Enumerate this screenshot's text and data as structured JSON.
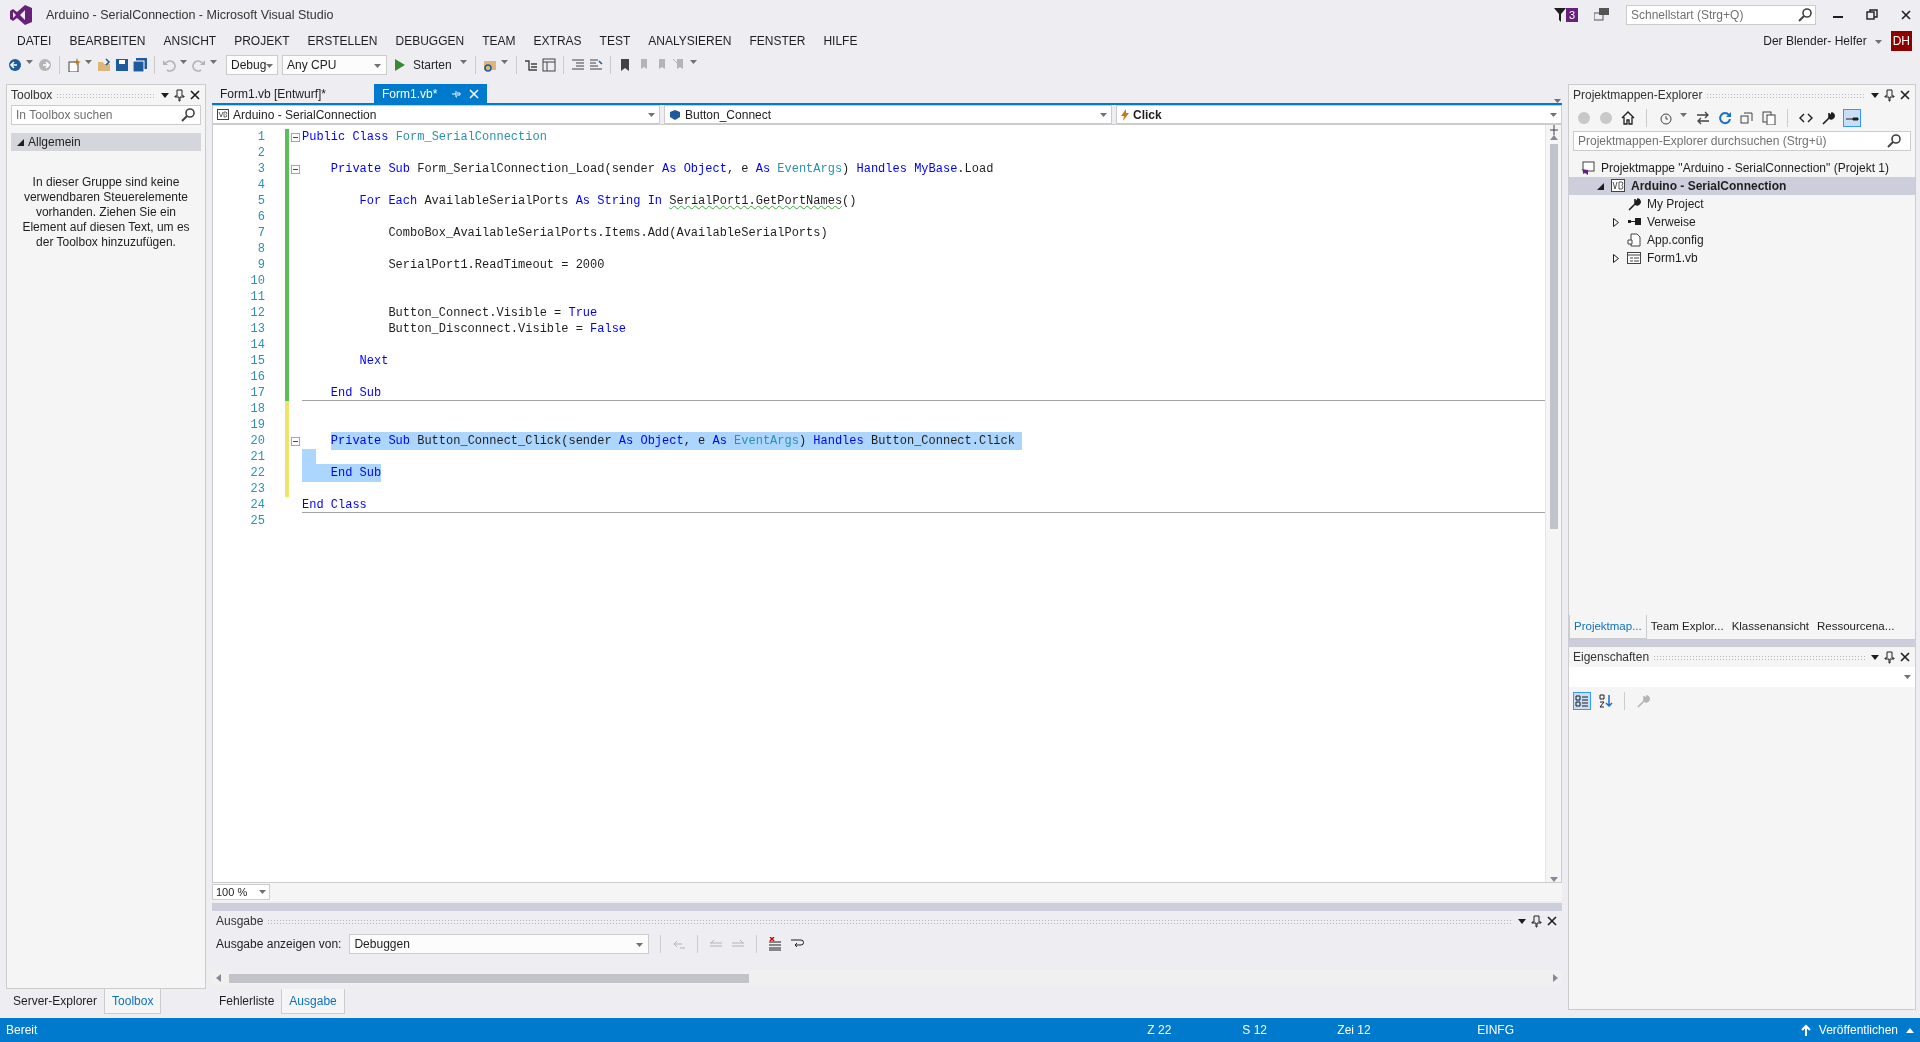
{
  "window": {
    "title": "Arduino - SerialConnection - Microsoft Visual Studio",
    "notification_count": "3",
    "quick_launch": {
      "placeholder": "Schnellstart (Strg+Q)"
    },
    "user": "Der Blender- Helfer",
    "user_initials": "DH"
  },
  "menu": [
    "DATEI",
    "BEARBEITEN",
    "ANSICHT",
    "PROJEKT",
    "ERSTELLEN",
    "DEBUGGEN",
    "TEAM",
    "EXTRAS",
    "TEST",
    "ANALYSIEREN",
    "FENSTER",
    "HILFE"
  ],
  "toolbar": {
    "configuration": "Debug",
    "platform": "Any CPU",
    "start": "Starten"
  },
  "toolbox": {
    "title": "Toolbox",
    "search": {
      "placeholder": "In Toolbox suchen"
    },
    "group": {
      "label": "Allgemein",
      "expanded": true
    },
    "empty_text": "In dieser Gruppe sind keine verwendbaren Steuerelemente vorhanden. Ziehen Sie ein Element auf diesen Text, um es der Toolbox hinzuzufügen."
  },
  "left_tabs": [
    {
      "label": "Server-Explorer",
      "selected": false
    },
    {
      "label": "Toolbox",
      "selected": true
    }
  ],
  "document_tabs": [
    {
      "label": "Form1.vb [Entwurf]*",
      "selected": false
    },
    {
      "label": "Form1.vb*",
      "selected": true
    }
  ],
  "navigation_bar": {
    "project": "Arduino - SerialConnection",
    "object": "Button_Connect",
    "event": "Click"
  },
  "code_lines": [
    {
      "number": "1",
      "color": "#57c157",
      "fold": true,
      "selected": false,
      "separator": false,
      "tokens": [
        {
          "text": "Public Class ",
          "kind": "kw"
        },
        {
          "text": "Form_SerialConnection",
          "kind": "type"
        }
      ]
    },
    {
      "number": "2",
      "color": "#57c157",
      "fold": false,
      "selected": false,
      "separator": false
    },
    {
      "number": "3",
      "color": "#57c157",
      "fold": true,
      "selected": false,
      "separator": false,
      "tokens": [
        {
          "text": "    Private Sub ",
          "kind": "kw"
        },
        {
          "text": "Form_SerialConnection_Load(sender ",
          "kind": "plain"
        },
        {
          "text": "As Object",
          "kind": "kw"
        },
        {
          "text": ", e ",
          "kind": "plain"
        },
        {
          "text": "As ",
          "kind": "kw"
        },
        {
          "text": "EventArgs",
          "kind": "type"
        },
        {
          "text": ") ",
          "kind": "plain"
        },
        {
          "text": "Handles MyBase",
          "kind": "kw"
        },
        {
          "text": ".Load",
          "kind": "plain"
        }
      ]
    },
    {
      "number": "4",
      "color": "#57c157",
      "fold": false,
      "selected": false,
      "separator": false
    },
    {
      "number": "5",
      "color": "#57c157",
      "fold": false,
      "selected": false,
      "separator": false,
      "tokens": [
        {
          "text": "        For Each ",
          "kind": "kw"
        },
        {
          "text": "AvailableSerialPorts ",
          "kind": "plain"
        },
        {
          "text": "As String In ",
          "kind": "kw"
        },
        {
          "text": "SerialPort1.GetPortNames",
          "kind": "squiggle"
        },
        {
          "text": "()",
          "kind": "plain"
        }
      ]
    },
    {
      "number": "6",
      "color": "#57c157",
      "fold": false,
      "selected": false,
      "separator": false
    },
    {
      "number": "7",
      "color": "#57c157",
      "fold": false,
      "selected": false,
      "separator": false,
      "tokens": [
        {
          "text": "            ComboBox_AvailableSerialPorts.Items.Add(AvailableSerialPorts)",
          "kind": "plain"
        }
      ]
    },
    {
      "number": "8",
      "color": "#57c157",
      "fold": false,
      "selected": false,
      "separator": false
    },
    {
      "number": "9",
      "color": "#57c157",
      "fold": false,
      "selected": false,
      "separator": false,
      "tokens": [
        {
          "text": "            SerialPort1.ReadTimeout = 2000",
          "kind": "plain"
        }
      ]
    },
    {
      "number": "10",
      "color": "#57c157",
      "fold": false,
      "selected": false,
      "separator": false
    },
    {
      "number": "11",
      "color": "#57c157",
      "fold": false,
      "selected": false,
      "separator": false
    },
    {
      "number": "12",
      "color": "#57c157",
      "fold": false,
      "selected": false,
      "separator": false,
      "tokens": [
        {
          "text": "            Button_Connect.Visible = ",
          "kind": "plain"
        },
        {
          "text": "True",
          "kind": "kw"
        }
      ]
    },
    {
      "number": "13",
      "color": "#57c157",
      "fold": false,
      "selected": false,
      "separator": false,
      "tokens": [
        {
          "text": "            Button_Disconnect.Visible = ",
          "kind": "plain"
        },
        {
          "text": "False",
          "kind": "kw"
        }
      ]
    },
    {
      "number": "14",
      "color": "#57c157",
      "fold": false,
      "selected": false,
      "separator": false
    },
    {
      "number": "15",
      "color": "#57c157",
      "fold": false,
      "selected": false,
      "separator": false,
      "tokens": [
        {
          "text": "        Next",
          "kind": "kw"
        }
      ]
    },
    {
      "number": "16",
      "color": "#57c157",
      "fold": false,
      "selected": false,
      "separator": false
    },
    {
      "number": "17",
      "color": "#57c157",
      "fold": false,
      "selected": false,
      "separator": true,
      "tokens": [
        {
          "text": "    End Sub",
          "kind": "kw"
        }
      ]
    },
    {
      "number": "18",
      "color": "#efe46b",
      "fold": false,
      "selected": false,
      "separator": false
    },
    {
      "number": "19",
      "color": "#efe46b",
      "fold": false,
      "selected": false,
      "separator": false
    },
    {
      "number": "20",
      "color": "#efe46b",
      "fold": true,
      "selected": true,
      "separator": false,
      "tokens": [
        {
          "text": "    Private Sub ",
          "kind": "kw"
        },
        {
          "text": "Button_Connect_Click(sender ",
          "kind": "plain"
        },
        {
          "text": "As Object",
          "kind": "kw"
        },
        {
          "text": ", e ",
          "kind": "plain"
        },
        {
          "text": "As ",
          "kind": "kw"
        },
        {
          "text": "EventArgs",
          "kind": "type"
        },
        {
          "text": ") ",
          "kind": "plain"
        },
        {
          "text": "Handles",
          "kind": "kw"
        },
        {
          "text": " Button_Connect.Click ",
          "kind": "plain"
        }
      ]
    },
    {
      "number": "21",
      "color": "#efe46b",
      "fold": false,
      "selected": true,
      "separator": false
    },
    {
      "number": "22",
      "color": "#efe46b",
      "fold": false,
      "selected": true,
      "separator": false,
      "tokens": [
        {
          "text": "    End Sub",
          "kind": "kw"
        }
      ]
    },
    {
      "number": "23",
      "color": "#efe46b",
      "fold": false,
      "selected": false,
      "separator": false
    },
    {
      "number": "24",
      "fold": false,
      "selected": false,
      "separator": true,
      "tokens": [
        {
          "text": "End Class",
          "kind": "kw"
        }
      ]
    },
    {
      "number": "25",
      "fold": false,
      "selected": false,
      "separator": false
    }
  ],
  "zoom": "100 %",
  "output": {
    "title": "Ausgabe",
    "source_label": "Ausgabe anzeigen von:",
    "source": "Debuggen"
  },
  "bottom_tabs": [
    {
      "label": "Fehlerliste",
      "selected": false
    },
    {
      "label": "Ausgabe",
      "selected": true
    }
  ],
  "solution_explorer": {
    "title": "Projektmappen-Explorer",
    "search": {
      "placeholder": "Projektmappen-Explorer durchsuchen (Strg+ü)"
    },
    "tree": [
      {
        "label": "Projektmappe \"Arduino - SerialConnection\" (Projekt 1)",
        "kind": "solution",
        "selected": false,
        "children": [
          {
            "label": "Arduino - SerialConnection",
            "kind": "project",
            "selected": true,
            "expanded": true,
            "children": [
              {
                "label": "My Project",
                "kind": "settings",
                "selected": false
              },
              {
                "label": "Verweise",
                "kind": "references",
                "selected": false,
                "expanded": false
              },
              {
                "label": "App.config",
                "kind": "config",
                "selected": false
              },
              {
                "label": "Form1.vb",
                "kind": "form",
                "selected": false,
                "expanded": false
              }
            ]
          }
        ]
      }
    ]
  },
  "right_tabs": [
    {
      "label": "Projektmap...",
      "selected": true
    },
    {
      "label": "Team Explor...",
      "selected": false
    },
    {
      "label": "Klassenansicht",
      "selected": false
    },
    {
      "label": "Ressourcena...",
      "selected": false
    }
  ],
  "properties": {
    "title": "Eigenschaften"
  },
  "status_bar": {
    "state": "Bereit",
    "line": "Z 22",
    "column": "S 12",
    "char": "Zei 12",
    "mode": "EINFG",
    "publish": "Veröffentlichen"
  }
}
